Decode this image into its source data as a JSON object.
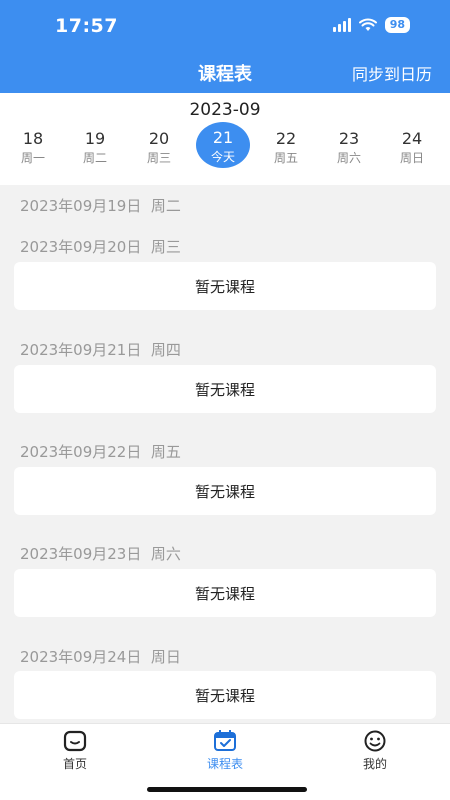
{
  "status_bar": {
    "time": "17:57",
    "battery": "98"
  },
  "header": {
    "title": "课程表",
    "sync_label": "同步到日历"
  },
  "date_strip": {
    "month": "2023-09",
    "days": [
      {
        "num": "18",
        "weekday": "周一"
      },
      {
        "num": "19",
        "weekday": "周二"
      },
      {
        "num": "20",
        "weekday": "周三"
      },
      {
        "num": "21",
        "weekday": "今天"
      },
      {
        "num": "22",
        "weekday": "周五"
      },
      {
        "num": "23",
        "weekday": "周六"
      },
      {
        "num": "24",
        "weekday": "周日"
      }
    ]
  },
  "schedule": [
    {
      "date": "2023年09月19日",
      "weekday": "周二",
      "note": ""
    },
    {
      "date": "2023年09月20日",
      "weekday": "周三",
      "note": "暂无课程"
    },
    {
      "date": "2023年09月21日",
      "weekday": "周四",
      "note": "暂无课程"
    },
    {
      "date": "2023年09月22日",
      "weekday": "周五",
      "note": "暂无课程"
    },
    {
      "date": "2023年09月23日",
      "weekday": "周六",
      "note": "暂无课程"
    },
    {
      "date": "2023年09月24日",
      "weekday": "周日",
      "note": "暂无课程"
    }
  ],
  "tabs": [
    {
      "label": "首页",
      "icon": "home-icon"
    },
    {
      "label": "课程表",
      "icon": "calendar-icon"
    },
    {
      "label": "我的",
      "icon": "smiley-icon"
    }
  ],
  "colors": {
    "accent": "#3d8ef0",
    "background": "#f2f2f2"
  }
}
